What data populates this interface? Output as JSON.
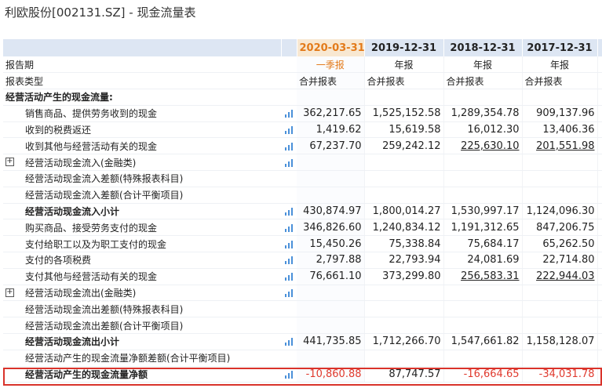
{
  "title": "利欧股份[002131.SZ] - 现金流量表",
  "periods": [
    {
      "date": "2020-03-31",
      "report": "一季报",
      "type": "合并报表",
      "current": true
    },
    {
      "date": "2019-12-31",
      "report": "年报",
      "type": "合并报表",
      "current": false
    },
    {
      "date": "2018-12-31",
      "report": "年报",
      "type": "合并报表",
      "current": false
    },
    {
      "date": "2017-12-31",
      "report": "年报",
      "type": "合并报表",
      "current": false
    }
  ],
  "meta_rows": {
    "report_period_label": "报告期",
    "report_type_label": "报表类型"
  },
  "colors": {
    "current_period": "#e37b1b",
    "negative": "#e03a2e",
    "header_bg": "#dde6f3",
    "highlight_border": "#d9332b",
    "chart_icon": "#4a90d9"
  },
  "rows": [
    {
      "label": "经营活动产生的现金流量:",
      "style": "section",
      "icon": false,
      "values": [
        "",
        "",
        "",
        ""
      ]
    },
    {
      "label": "销售商品、提供劳务收到的现金",
      "style": "indent",
      "icon": true,
      "values": [
        "362,217.65",
        "1,525,152.58",
        "1,289,354.78",
        "909,137.96"
      ]
    },
    {
      "label": "收到的税费返还",
      "style": "indent",
      "icon": true,
      "values": [
        "1,419.62",
        "15,619.58",
        "16,012.30",
        "13,406.36"
      ]
    },
    {
      "label": "收到其他与经营活动有关的现金",
      "style": "indent",
      "icon": true,
      "values": [
        "67,237.70",
        "259,242.12",
        "225,630.10",
        "201,551.98"
      ],
      "links": [
        false,
        false,
        true,
        true
      ]
    },
    {
      "label": "经营活动现金流入(金融类)",
      "style": "expand",
      "icon": true,
      "values": [
        "",
        "",
        "",
        ""
      ]
    },
    {
      "label": "经营活动现金流入差额(特殊报表科目)",
      "style": "indent",
      "icon": false,
      "values": [
        "",
        "",
        "",
        ""
      ]
    },
    {
      "label": "经营活动现金流入差额(合计平衡项目)",
      "style": "indent",
      "icon": false,
      "values": [
        "",
        "",
        "",
        ""
      ]
    },
    {
      "label": "经营活动现金流入小计",
      "style": "indent-bold",
      "icon": true,
      "values": [
        "430,874.97",
        "1,800,014.27",
        "1,530,997.17",
        "1,124,096.30"
      ]
    },
    {
      "label": "购买商品、接受劳务支付的现金",
      "style": "indent",
      "icon": true,
      "values": [
        "346,826.60",
        "1,240,834.12",
        "1,191,312.65",
        "847,206.75"
      ]
    },
    {
      "label": "支付给职工以及为职工支付的现金",
      "style": "indent",
      "icon": true,
      "values": [
        "15,450.26",
        "75,338.84",
        "75,684.17",
        "65,262.50"
      ]
    },
    {
      "label": "支付的各项税费",
      "style": "indent",
      "icon": true,
      "values": [
        "2,797.88",
        "22,793.94",
        "24,081.69",
        "22,714.80"
      ]
    },
    {
      "label": "支付其他与经营活动有关的现金",
      "style": "indent",
      "icon": true,
      "values": [
        "76,661.10",
        "373,299.80",
        "256,583.31",
        "222,944.03"
      ],
      "links": [
        false,
        false,
        true,
        true
      ]
    },
    {
      "label": "经营活动现金流出(金融类)",
      "style": "expand",
      "icon": true,
      "values": [
        "",
        "",
        "",
        ""
      ]
    },
    {
      "label": "经营活动现金流出差额(特殊报表科目)",
      "style": "indent",
      "icon": false,
      "values": [
        "",
        "",
        "",
        ""
      ]
    },
    {
      "label": "经营活动现金流出差额(合计平衡项目)",
      "style": "indent",
      "icon": false,
      "values": [
        "",
        "",
        "",
        ""
      ]
    },
    {
      "label": "经营活动现金流出小计",
      "style": "indent-bold",
      "icon": true,
      "values": [
        "441,735.85",
        "1,712,266.70",
        "1,547,661.82",
        "1,158,128.07"
      ]
    },
    {
      "label": "经营活动产生的现金流量净额差额(合计平衡项目)",
      "style": "indent",
      "icon": false,
      "values": [
        "",
        "",
        "",
        ""
      ]
    },
    {
      "label": "经营活动产生的现金流量净额",
      "style": "indent-bold",
      "icon": true,
      "values": [
        "-10,860.88",
        "87,747.57",
        "-16,664.65",
        "-34,031.78"
      ],
      "highlight": true
    }
  ]
}
